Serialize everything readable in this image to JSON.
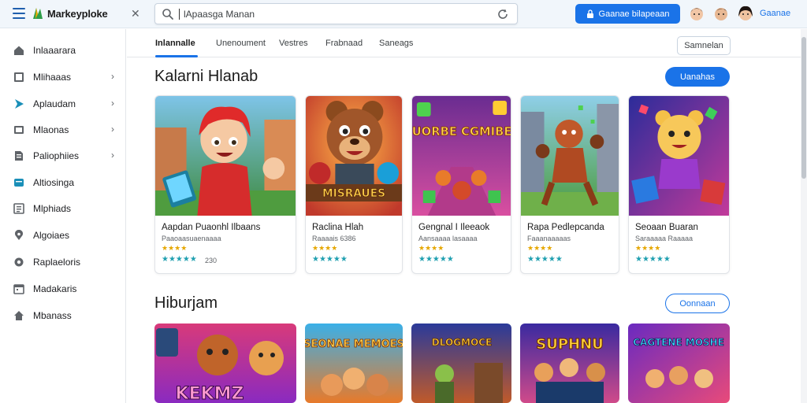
{
  "header": {
    "app_name": "Markeyploke",
    "search_value": "lApaasga Manan",
    "signin_label": "Gaanae bilapeaan",
    "account_label": "Gaanae"
  },
  "sidebar": {
    "items": [
      {
        "label": "Inlaaarara",
        "icon": "home-icon",
        "chevron": false
      },
      {
        "label": "Mlihaaas",
        "icon": "grid-icon",
        "chevron": true
      },
      {
        "label": "Aplaudam",
        "icon": "play-icon",
        "chevron": true
      },
      {
        "label": "Mlaonas",
        "icon": "folder-icon",
        "chevron": true
      },
      {
        "label": "Paliophiies",
        "icon": "document-icon",
        "chevron": true
      },
      {
        "label": "Altiosinga",
        "icon": "message-icon",
        "chevron": false
      },
      {
        "label": "Mlphiads",
        "icon": "list-icon",
        "chevron": false
      },
      {
        "label": "Algoiaes",
        "icon": "location-icon",
        "chevron": false
      },
      {
        "label": "Raplaeloris",
        "icon": "settings-icon",
        "chevron": false
      },
      {
        "label": "Madakaris",
        "icon": "calendar-icon",
        "chevron": false
      },
      {
        "label": "Mbanass",
        "icon": "shield-icon",
        "chevron": false
      }
    ]
  },
  "tabs": {
    "items": [
      "Inlannalle",
      "Unenoument",
      "Vestres",
      "Frabnaad",
      "Saneags"
    ],
    "sort_label": "Samnelan"
  },
  "sections": [
    {
      "title": "Kalarni Hlanab",
      "button_label": "Uanahas",
      "cards": [
        {
          "title": "Aapdan Puaonhl Ilbaans",
          "subtitle": "Paaoaasuaenaaaa",
          "stars_gold": "★★★★",
          "stars_teal": "★★★★★",
          "rating": "230"
        },
        {
          "title": "Raclina Hlah",
          "subtitle": "Raaaais 6386",
          "stars_gold": "★★★★",
          "stars_teal": "★★★★★",
          "rating": ""
        },
        {
          "title": "Gengnal I Ileeaok",
          "subtitle": "Aansaaaa lasaaaa",
          "stars_gold": "★★★★",
          "stars_teal": "★★★★★",
          "rating": ""
        },
        {
          "title": "Rapa Pedlepcanda",
          "subtitle": "Faaanaaaaas",
          "stars_gold": "★★★★",
          "stars_teal": "★★★★★",
          "rating": ""
        },
        {
          "title": "Seoaan Buaran",
          "subtitle": "Saraaaaa Raaaaa",
          "stars_gold": "★★★★",
          "stars_teal": "★★★★★",
          "rating": ""
        }
      ]
    },
    {
      "title": "Hiburjam",
      "button_label": "Oonnaan",
      "cards": []
    }
  ],
  "art_text": {
    "card2": "MISRAUES",
    "card3": "CUORBE CGMIBES",
    "row2_card1": "KEKMZ",
    "row2_card2": "SEONAE MEMOES",
    "row2_card3": "DLOGMOCE",
    "row2_card4": "SUPHNU",
    "row2_card5": "CAGTENE MOSHE"
  },
  "colors": {
    "accent": "#1a73e8",
    "star_gold": "#e6a700",
    "star_teal": "#20a0b0"
  }
}
